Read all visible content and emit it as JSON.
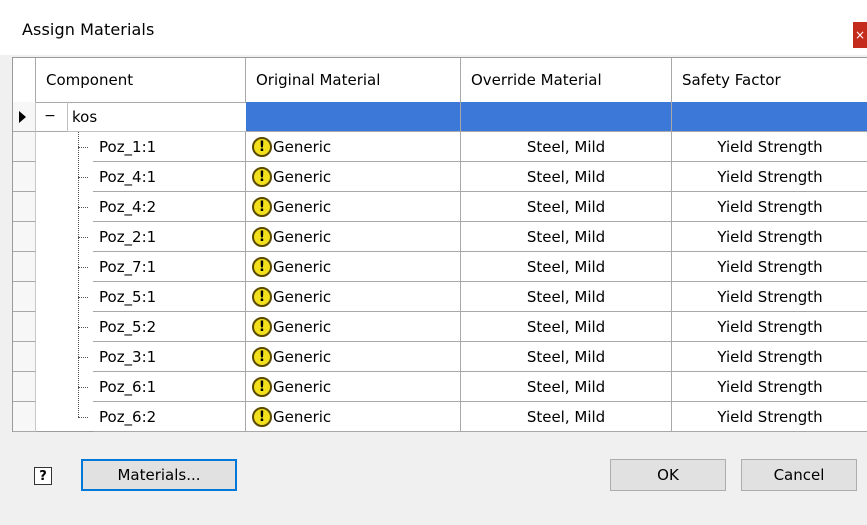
{
  "window": {
    "title": "Assign Materials"
  },
  "grid": {
    "columns": [
      "Component",
      "Original Material",
      "Override Material",
      "Safety Factor"
    ],
    "root": {
      "label": "kos",
      "collapse_symbol": "−"
    },
    "rows": [
      {
        "component": "Poz_1:1",
        "original": "Generic",
        "override": "Steel, Mild",
        "safety": "Yield Strength"
      },
      {
        "component": "Poz_4:1",
        "original": "Generic",
        "override": "Steel, Mild",
        "safety": "Yield Strength"
      },
      {
        "component": "Poz_4:2",
        "original": "Generic",
        "override": "Steel, Mild",
        "safety": "Yield Strength"
      },
      {
        "component": "Poz_2:1",
        "original": "Generic",
        "override": "Steel, Mild",
        "safety": "Yield Strength"
      },
      {
        "component": "Poz_7:1",
        "original": "Generic",
        "override": "Steel, Mild",
        "safety": "Yield Strength"
      },
      {
        "component": "Poz_5:1",
        "original": "Generic",
        "override": "Steel, Mild",
        "safety": "Yield Strength"
      },
      {
        "component": "Poz_5:2",
        "original": "Generic",
        "override": "Steel, Mild",
        "safety": "Yield Strength"
      },
      {
        "component": "Poz_3:1",
        "original": "Generic",
        "override": "Steel, Mild",
        "safety": "Yield Strength"
      },
      {
        "component": "Poz_6:1",
        "original": "Generic",
        "override": "Steel, Mild",
        "safety": "Yield Strength"
      },
      {
        "component": "Poz_6:2",
        "original": "Generic",
        "override": "Steel, Mild",
        "safety": "Yield Strength"
      }
    ],
    "warning_icon_glyph": "!"
  },
  "footer": {
    "help_glyph": "?",
    "materials_label": "Materials...",
    "ok_label": "OK",
    "cancel_label": "Cancel"
  },
  "colors": {
    "selection": "#3b78d8",
    "warning": "#f2e01c",
    "close": "#c42b1c"
  }
}
